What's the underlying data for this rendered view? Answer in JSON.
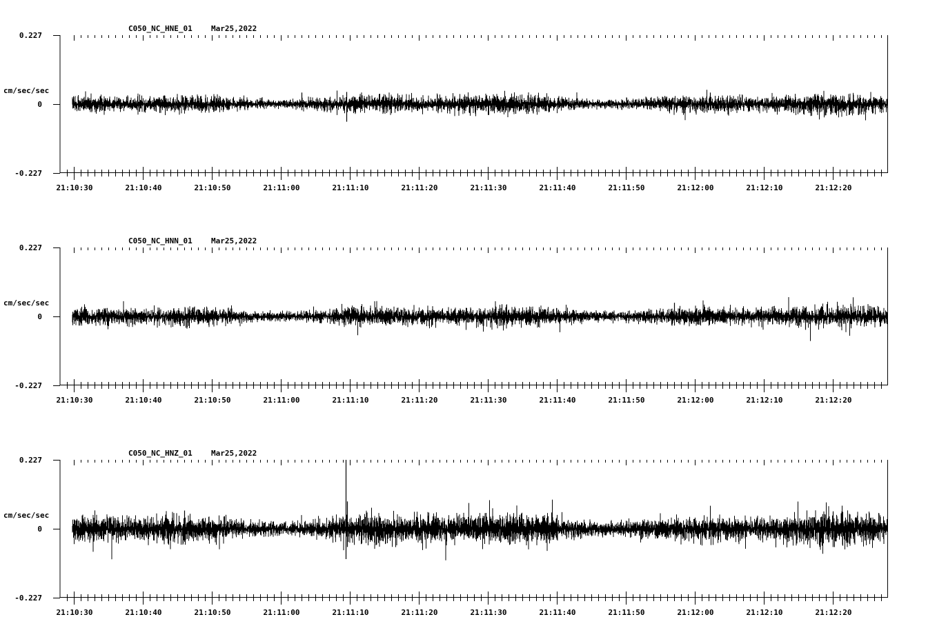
{
  "page": {
    "background": "#ffffff",
    "ink": "#000000"
  },
  "chart_data": [
    {
      "type": "line",
      "title": "C050_NC_HNE_01",
      "date": "Mar25,2022",
      "ylabel": "cm/sec/sec",
      "ylim": [
        -0.227,
        0.227
      ],
      "ytick_labels": [
        "0.227",
        "0",
        "-0.227"
      ],
      "xtick_labels": [
        "21:10:30",
        "21:10:40",
        "21:10:50",
        "21:11:00",
        "21:11:10",
        "21:11:20",
        "21:11:30",
        "21:11:40",
        "21:11:50",
        "21:12:00",
        "21:12:10",
        "21:12:20"
      ],
      "x_start_s": 0,
      "x_end_s": 118,
      "data_start_s": 0,
      "series": [
        {
          "noise_amplitude": 0.025,
          "spikes": [
            {
              "t": 39.5,
              "high": 0.04,
              "low": -0.058
            },
            {
              "t": 33.0,
              "high": 0.038,
              "low": -0.02
            },
            {
              "t": 92.2,
              "high": 0.038,
              "low": -0.02
            },
            {
              "t": 64.0,
              "high": 0.02,
              "low": -0.032
            }
          ]
        }
      ]
    },
    {
      "type": "line",
      "title": "C050_NC_HNN_01",
      "date": "Mar25,2022",
      "ylabel": "cm/sec/sec",
      "ylim": [
        -0.227,
        0.227
      ],
      "ytick_labels": [
        "0.227",
        "0",
        "-0.227"
      ],
      "xtick_labels": [
        "21:10:30",
        "21:10:40",
        "21:10:50",
        "21:11:00",
        "21:11:10",
        "21:11:20",
        "21:11:30",
        "21:11:40",
        "21:11:50",
        "21:12:00",
        "21:12:10",
        "21:12:20"
      ],
      "x_start_s": 0,
      "x_end_s": 118,
      "data_start_s": 0,
      "series": [
        {
          "noise_amplitude": 0.027,
          "spikes": [
            {
              "t": 87.0,
              "high": 0.045,
              "low": -0.03
            },
            {
              "t": 62.0,
              "high": 0.04,
              "low": -0.03
            },
            {
              "t": 106.0,
              "high": 0.028,
              "low": -0.044
            }
          ]
        }
      ]
    },
    {
      "type": "line",
      "title": "C050_NC_HNZ_01",
      "date": "Mar25,2022",
      "ylabel": "cm/sec/sec",
      "ylim": [
        -0.227,
        0.227
      ],
      "ytick_labels": [
        "0.227",
        "0",
        "-0.227"
      ],
      "xtick_labels": [
        "21:10:30",
        "21:10:40",
        "21:10:50",
        "21:11:00",
        "21:11:10",
        "21:11:20",
        "21:11:30",
        "21:11:40",
        "21:11:50",
        "21:12:00",
        "21:12:10",
        "21:12:20"
      ],
      "x_start_s": 0,
      "x_end_s": 118,
      "data_start_s": 0,
      "series": [
        {
          "noise_amplitude": 0.04,
          "spikes": [
            {
              "t": 39.4,
              "high": 0.227,
              "low": -0.1
            },
            {
              "t": 39.6,
              "high": 0.09,
              "low": -0.06
            },
            {
              "t": 110.0,
              "high": 0.055,
              "low": -0.06
            },
            {
              "t": 16.0,
              "high": 0.06,
              "low": -0.035
            }
          ]
        }
      ]
    }
  ]
}
